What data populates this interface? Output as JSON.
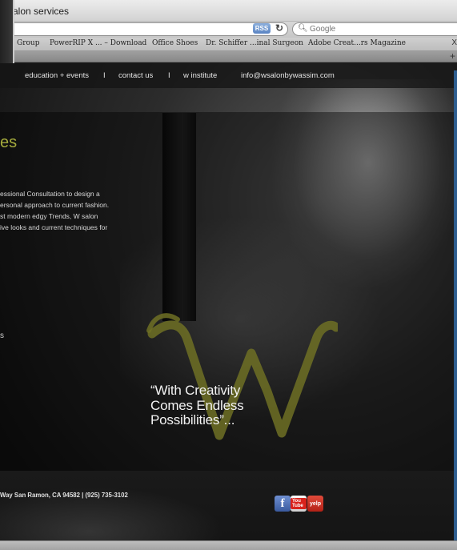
{
  "browser": {
    "window_title": "alon services",
    "rss_label": "RSS",
    "search_placeholder": "Google",
    "bookmarks": [
      "Group",
      "PowerRIP X ... – Download",
      "Office Shoes",
      "Dr. Schiffer ...inal Surgeon",
      "Adobe Creat...rs Magazine"
    ],
    "bookmarks_more": "X",
    "new_tab": "+"
  },
  "nav": {
    "items": [
      "education + events",
      "contact us",
      "w institute",
      "info@wsalonbywassim.com"
    ],
    "separator": "I"
  },
  "content": {
    "section_title": "es",
    "intro_lines": [
      "essional Consultation to design a",
      "ersonal approach to current fashion.",
      "st modern edgy Trends, W salon",
      "ive looks and current techniques for"
    ],
    "small_text": "s",
    "logo_letter": "W",
    "quote_lines": [
      "“With Creativity",
      "Comes Endless",
      "Possibilities”..."
    ]
  },
  "footer": {
    "address": "Way San Ramon, CA 94582  |  (925) 735-3102",
    "social": [
      {
        "name": "facebook",
        "label": "f"
      },
      {
        "name": "youtube",
        "label": "You Tube"
      },
      {
        "name": "yelp",
        "label": "yelp"
      }
    ]
  },
  "colors": {
    "accent_olive": "#a5ab3d",
    "nav_text": "#e4e4e4",
    "quote_text": "#f2f2f2"
  }
}
